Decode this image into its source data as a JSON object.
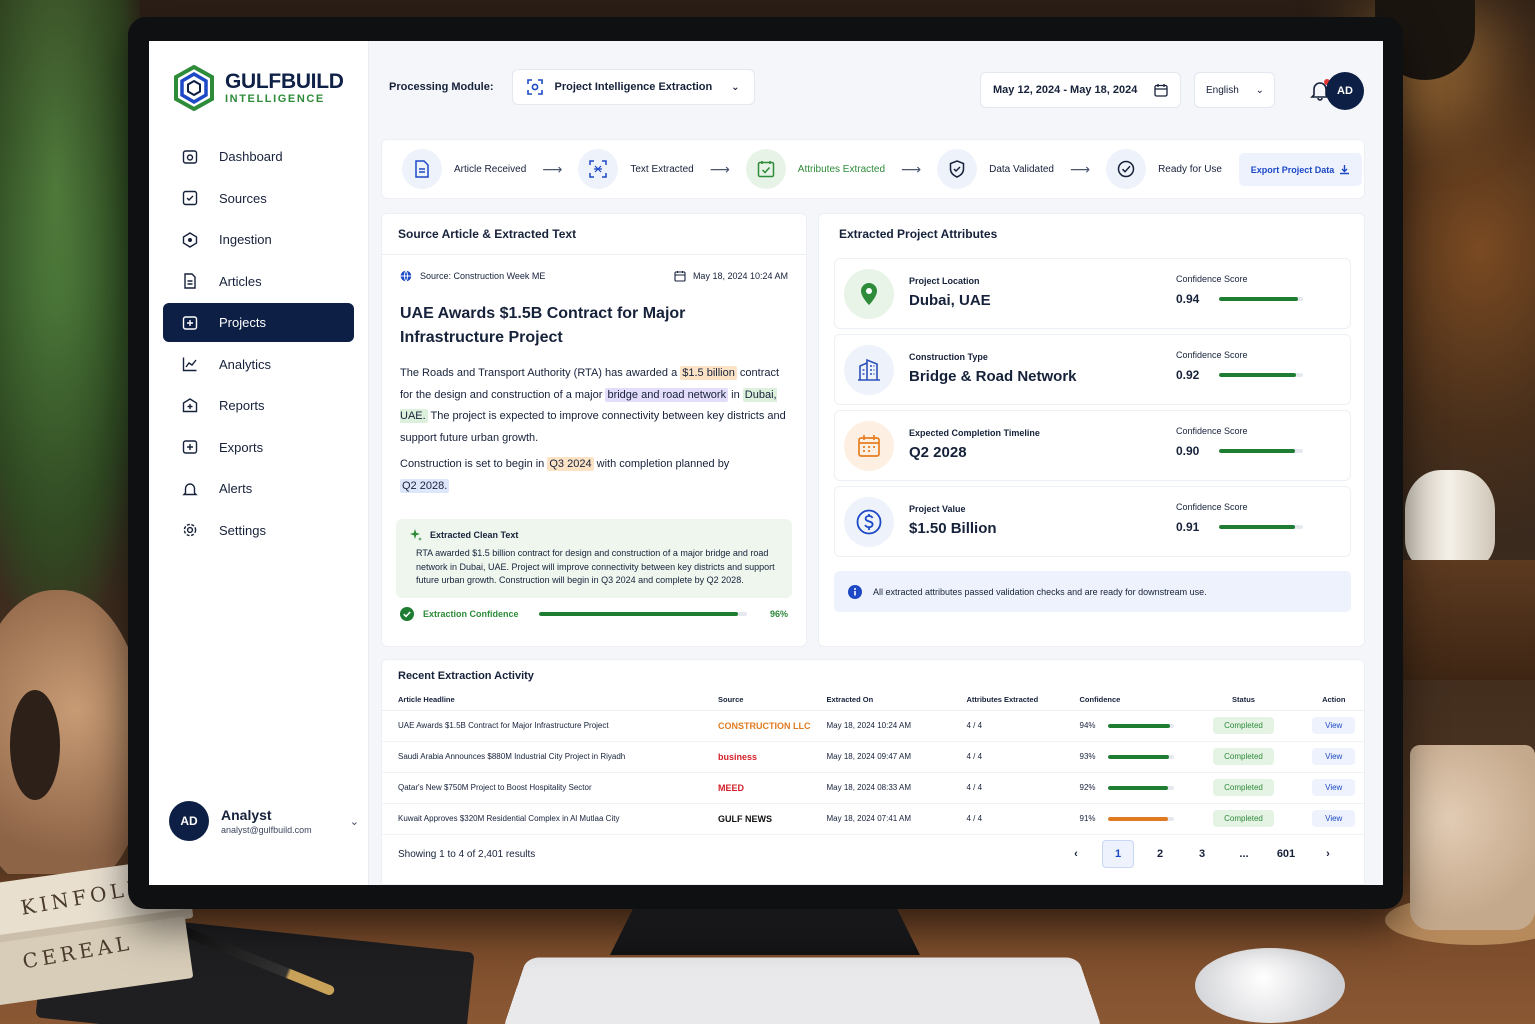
{
  "brand": {
    "name": "GULFBUILD",
    "sub": "INTELLIGENCE"
  },
  "sidebar": {
    "items": [
      {
        "label": "Dashboard",
        "icon": "camera-icon"
      },
      {
        "label": "Sources",
        "icon": "check-square-icon"
      },
      {
        "label": "Ingestion",
        "icon": "ingestion-icon"
      },
      {
        "label": "Articles",
        "icon": "document-icon"
      },
      {
        "label": "Projects",
        "icon": "plus-folder-icon",
        "active": true
      },
      {
        "label": "Analytics",
        "icon": "line-chart-icon"
      },
      {
        "label": "Reports",
        "icon": "report-icon"
      },
      {
        "label": "Exports",
        "icon": "export-icon"
      },
      {
        "label": "Alerts",
        "icon": "bell-icon"
      },
      {
        "label": "Settings",
        "icon": "gear-icon"
      }
    ],
    "user": {
      "initials": "AD",
      "name": "Analyst",
      "email": "analyst@gulfbuild.com"
    }
  },
  "topbar": {
    "module_label": "Processing Module:",
    "module_value": "Project Intelligence Extraction",
    "date_range": "May 12, 2024 - May 18, 2024",
    "language": "English",
    "avatar": "AD"
  },
  "pipeline": {
    "steps": [
      "Article Received",
      "Text Extracted",
      "Attributes Extracted",
      "Data Validated",
      "Ready for Use"
    ],
    "active_step": 2,
    "export_label": "Export Project Data"
  },
  "source": {
    "card_title": "Source Article & Extracted Text",
    "source_label": "Source:",
    "source_name": "Construction Week ME",
    "date": "May 18, 2024 10:24 AM",
    "title": "UAE Awards $1.5B Contract for Major Infrastructure Project",
    "para1": {
      "t1": "The Roads and Transport Authority (RTA) has awarded a ",
      "h1": "$1.5 billion",
      "t2": " contract for the design and construction of a major ",
      "h2": "bridge and road network",
      "t3": " in ",
      "h3": "Dubai, UAE.",
      "t4": " The project is expected to improve connectivity between key districts and support future urban growth."
    },
    "para2": {
      "t1": "Construction is set to begin in ",
      "h1": "Q3 2024",
      "t2": " with completion planned by ",
      "h2": "Q2 2028."
    },
    "clean_title": "Extracted Clean Text",
    "clean_text": "RTA awarded $1.5 billion contract for design and construction of a major bridge and road network in Dubai, UAE. Project will improve connectivity between key districts and support future urban growth. Construction will begin in Q3 2024 and complete by Q2 2028.",
    "confidence_label": "Extraction Confidence",
    "confidence_value": "96%",
    "confidence": 0.96
  },
  "attributes": {
    "card_title": "Extracted Project Attributes",
    "items": [
      {
        "label": "Project Location",
        "value": "Dubai, UAE",
        "conf_label": "Confidence Score",
        "conf": "0.94",
        "score": 0.94,
        "icon": "location-pin-icon",
        "color": "#2e8b3a",
        "bg": "#e8f4e8"
      },
      {
        "label": "Construction Type",
        "value": "Bridge & Road Network",
        "conf_label": "Confidence Score",
        "conf": "0.92",
        "score": 0.92,
        "icon": "building-icon",
        "color": "#2d4fb8",
        "bg": "#eef2fb"
      },
      {
        "label": "Expected Completion Timeline",
        "value": "Q2 2028",
        "conf_label": "Confidence Score",
        "conf": "0.90",
        "score": 0.9,
        "icon": "calendar-icon",
        "color": "#e67e22",
        "bg": "#fdf0e3"
      },
      {
        "label": "Project Value",
        "value": "$1.50 Billion",
        "conf_label": "Confidence Score",
        "conf": "0.91",
        "score": 0.91,
        "icon": "dollar-icon",
        "color": "#1d49c6",
        "bg": "#eef2fb"
      }
    ],
    "notice": "All extracted attributes passed validation checks and are ready for downstream use."
  },
  "activity": {
    "title": "Recent Extraction Activity",
    "columns": [
      "Article Headline",
      "Source",
      "Extracted On",
      "Attributes Extracted",
      "Confidence",
      "Status",
      "Action"
    ],
    "rows": [
      {
        "headline": "UAE Awards $1.5B Contract for Major Infrastructure Project",
        "source": "CONSTRUCTION LLC",
        "source_color": "#e07b22",
        "date": "May 18, 2024 10:24 AM",
        "attrs": "4 / 4",
        "conf": "94%",
        "score": 0.94,
        "bar_color": "#1e7d32",
        "status": "Completed",
        "action": "View"
      },
      {
        "headline": "Saudi Arabia Announces $880M Industrial City Project in Riyadh",
        "source": "business",
        "source_color": "#d3202a",
        "date": "May 18, 2024 09:47 AM",
        "attrs": "4 / 4",
        "conf": "93%",
        "score": 0.93,
        "bar_color": "#1e7d32",
        "status": "Completed",
        "action": "View"
      },
      {
        "headline": "Qatar's New $750M Project to Boost Hospitality Sector",
        "source": "MEED",
        "source_color": "#d3202a",
        "date": "May 18, 2024 08:33 AM",
        "attrs": "4 / 4",
        "conf": "92%",
        "score": 0.92,
        "bar_color": "#1e7d32",
        "status": "Completed",
        "action": "View"
      },
      {
        "headline": "Kuwait Approves $320M Residential Complex in Al Mutlaa City",
        "source": "GULF NEWS",
        "source_color": "#111111",
        "date": "May 18, 2024 07:41 AM",
        "attrs": "4 / 4",
        "conf": "91%",
        "score": 0.91,
        "bar_color": "#e07b22",
        "status": "Completed",
        "action": "View"
      }
    ],
    "showing": "Showing 1 to 4 of 2,401 results",
    "pages": [
      "1",
      "2",
      "3",
      "...",
      "601"
    ]
  },
  "scene": {
    "book_1": "KINFOLK",
    "book_2": "CEREAL"
  }
}
